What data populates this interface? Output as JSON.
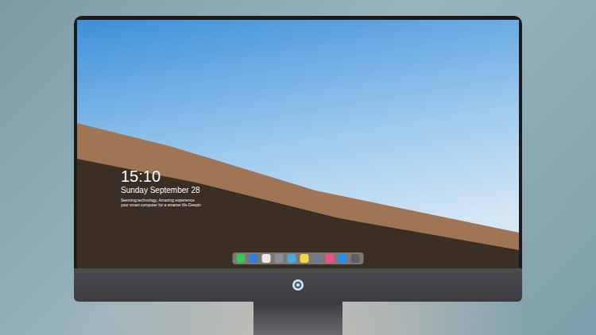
{
  "lock_screen": {
    "time": "15:10",
    "date": "Sunday September 28",
    "tagline": [
      "Seeming technology, Amazing experience",
      "your smart computer for a smarter life-Deepin"
    ]
  },
  "dock": {
    "apps": [
      {
        "color": "#3cc35a"
      },
      {
        "color": "#2f7fe0"
      },
      {
        "color": "#e8e8e8"
      },
      {
        "color": "#8a8f98"
      },
      {
        "color": "#4aa7e0"
      },
      {
        "color": "#f5d547"
      },
      {
        "color": "#6b7a8c"
      },
      {
        "color": "#f0508a"
      },
      {
        "color": "#2a8cf0"
      },
      {
        "color": "#5a5d63"
      }
    ]
  }
}
